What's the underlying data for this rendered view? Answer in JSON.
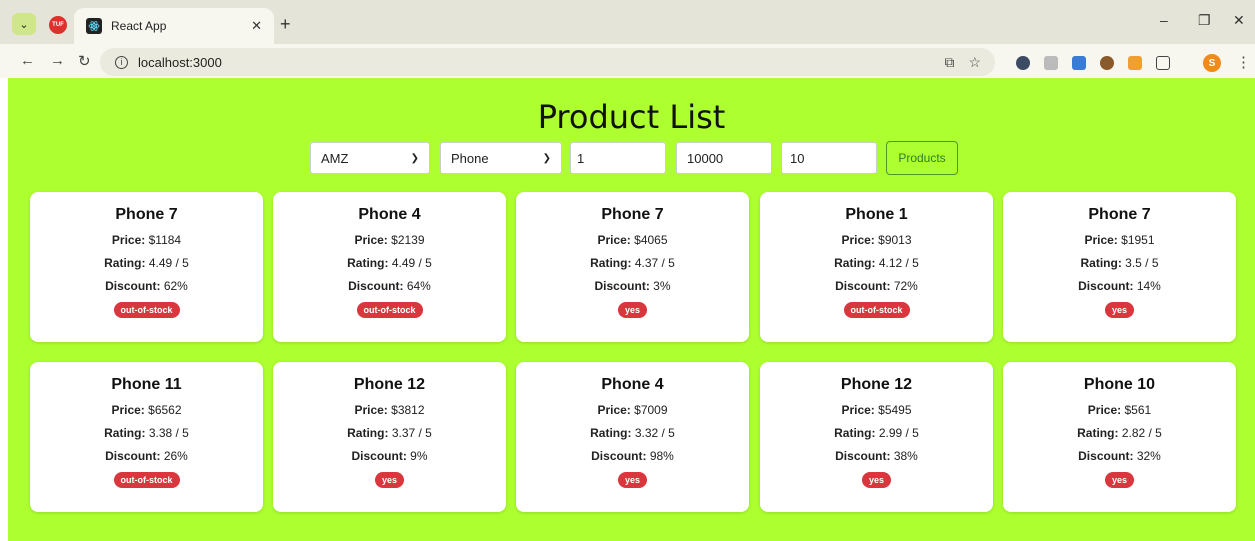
{
  "browser": {
    "tab_title": "React App",
    "url": "localhost:3000",
    "profile_initial": "S",
    "other_tab_icon": "TUF"
  },
  "page": {
    "title": "Product List"
  },
  "filters": {
    "company": "AMZ",
    "category": "Phone",
    "min_price": "1",
    "max_price": "10000",
    "top_n": "10",
    "button_label": "Products"
  },
  "labels": {
    "price": "Price:",
    "rating": "Rating:",
    "discount": "Discount:"
  },
  "products": [
    {
      "name": "Phone 7",
      "price": "$1184",
      "rating": "4.49 / 5",
      "discount": "62%",
      "availability": "out-of-stock"
    },
    {
      "name": "Phone 4",
      "price": "$2139",
      "rating": "4.49 / 5",
      "discount": "64%",
      "availability": "out-of-stock"
    },
    {
      "name": "Phone 7",
      "price": "$4065",
      "rating": "4.37 / 5",
      "discount": "3%",
      "availability": "yes"
    },
    {
      "name": "Phone 1",
      "price": "$9013",
      "rating": "4.12 / 5",
      "discount": "72%",
      "availability": "out-of-stock"
    },
    {
      "name": "Phone 7",
      "price": "$1951",
      "rating": "3.5 / 5",
      "discount": "14%",
      "availability": "yes"
    },
    {
      "name": "Phone 11",
      "price": "$6562",
      "rating": "3.38 / 5",
      "discount": "26%",
      "availability": "out-of-stock"
    },
    {
      "name": "Phone 12",
      "price": "$3812",
      "rating": "3.37 / 5",
      "discount": "9%",
      "availability": "yes"
    },
    {
      "name": "Phone 4",
      "price": "$7009",
      "rating": "3.32 / 5",
      "discount": "98%",
      "availability": "yes"
    },
    {
      "name": "Phone 12",
      "price": "$5495",
      "rating": "2.99 / 5",
      "discount": "38%",
      "availability": "yes"
    },
    {
      "name": "Phone 10",
      "price": "$561",
      "rating": "2.82 / 5",
      "discount": "32%",
      "availability": "yes"
    }
  ],
  "colors": {
    "page_bg": "#adff2f",
    "badge": "#d9363e",
    "button_border": "#4a9a2a"
  }
}
